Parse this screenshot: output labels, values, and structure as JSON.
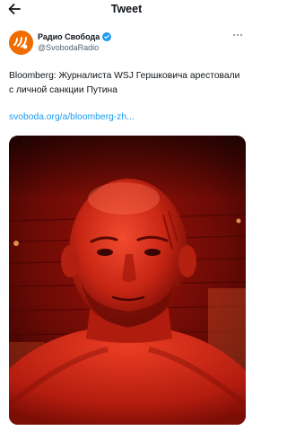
{
  "header": {
    "title": "Tweet",
    "back_icon": "arrow-left-icon"
  },
  "author": {
    "display_name": "Радио Свобода",
    "handle": "@SvobodaRadio",
    "verified": true,
    "avatar_icon": "radio-svoboda-logo",
    "avatar_color": "#ef6c00",
    "verified_color": "#1d9bf0"
  },
  "tweet": {
    "text": "Bloomberg: Журналиста WSJ Гершковича арестовали с личной санкции Путина",
    "link": "svoboda.org/a/bloomberg-zh...",
    "link_color": "#1d9bf0",
    "more_icon": "more-horizontal-icon"
  },
  "media": {
    "type": "photo"
  }
}
